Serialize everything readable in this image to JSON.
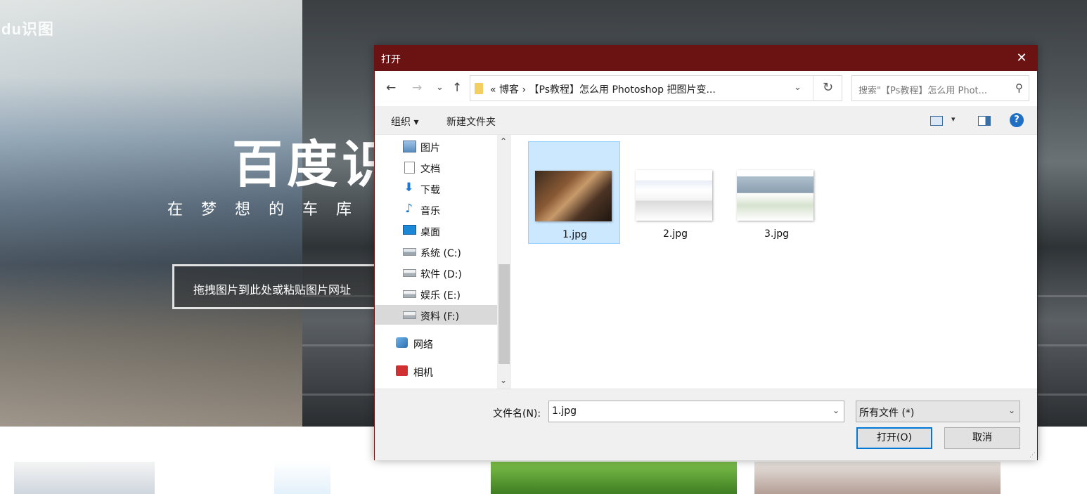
{
  "page": {
    "logo": "du识图",
    "hero_title": "百度识",
    "hero_subtitle": "在梦想的车库",
    "drop_hint": "拖拽图片到此处或粘贴图片网址"
  },
  "dialog": {
    "title": "打开",
    "close": "✕",
    "nav": {
      "back": "←",
      "forward": "→",
      "recent": "⌄",
      "up": "↑"
    },
    "address": "«  博客  ›  【Ps教程】怎么用 Photoshop 把图片变...",
    "refresh": "↻",
    "search_placeholder": "搜索\"【Ps教程】怎么用 Phot...",
    "toolbar": {
      "organize": "组织 ▾",
      "new_folder": "新建文件夹",
      "help": "?"
    },
    "nav_items": [
      {
        "label": "图片",
        "icon": "pictures-icon"
      },
      {
        "label": "文档",
        "icon": "documents-icon"
      },
      {
        "label": "下载",
        "icon": "download-icon"
      },
      {
        "label": "音乐",
        "icon": "music-icon"
      },
      {
        "label": "桌面",
        "icon": "desktop-icon"
      },
      {
        "label": "系统 (C:)",
        "icon": "drive-icon"
      },
      {
        "label": "软件 (D:)",
        "icon": "drive-icon"
      },
      {
        "label": "娱乐 (E:)",
        "icon": "drive-icon"
      },
      {
        "label": "资料 (F:)",
        "icon": "drive-icon"
      },
      {
        "label": "网络",
        "icon": "network-icon"
      },
      {
        "label": "相机",
        "icon": "camera-icon"
      }
    ],
    "files": [
      {
        "name": "1.jpg",
        "selected": true
      },
      {
        "name": "2.jpg",
        "selected": false
      },
      {
        "name": "3.jpg",
        "selected": false
      }
    ],
    "filename_label": "文件名(N):",
    "filename_value": "1.jpg",
    "filetype_value": "所有文件 (*)",
    "open_button": "打开(O)",
    "cancel_button": "取消",
    "colors": {
      "titlebar": "#6b1212",
      "selection": "#cce8ff",
      "primary_border": "#0078d7"
    }
  }
}
